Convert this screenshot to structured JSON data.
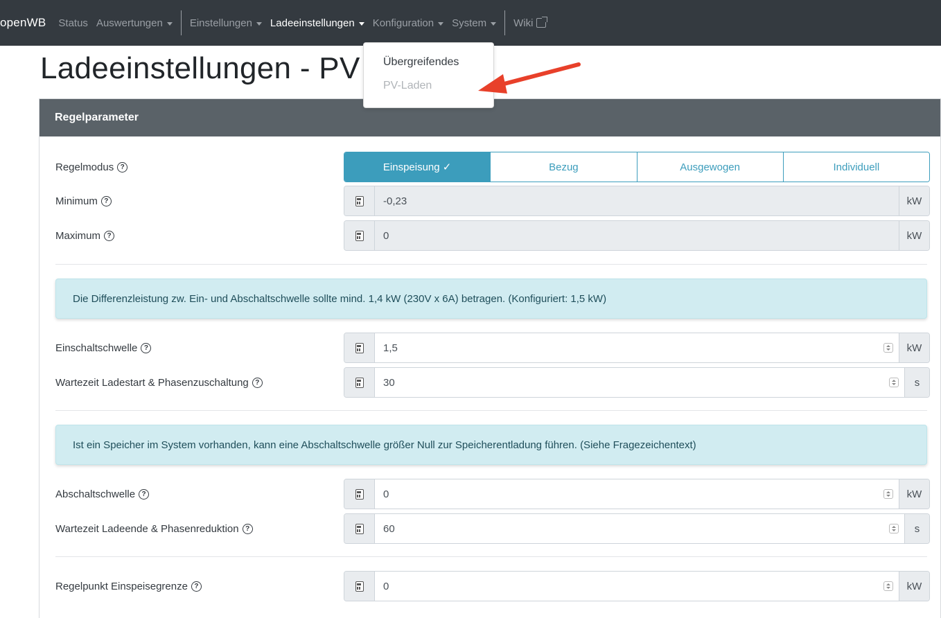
{
  "navbar": {
    "brand": "openWB",
    "items": [
      {
        "label": "Status"
      },
      {
        "label": "Auswertungen"
      },
      {
        "label": "Einstellungen"
      },
      {
        "label": "Ladeeinstellungen"
      },
      {
        "label": "Konfiguration"
      },
      {
        "label": "System"
      },
      {
        "label": "Wiki"
      }
    ]
  },
  "dropdown": {
    "items": [
      {
        "label": "Übergreifendes"
      },
      {
        "label": "PV-Laden"
      }
    ]
  },
  "page": {
    "title": "Ladeeinstellungen - PV"
  },
  "card": {
    "header": "Regelparameter",
    "regelmodus": {
      "label": "Regelmodus",
      "options": [
        "Einspeisung ✓",
        "Bezug",
        "Ausgewogen",
        "Individuell"
      ],
      "selected": "Einspeisung"
    },
    "minimum": {
      "label": "Minimum",
      "value": "-0,23",
      "unit": "kW"
    },
    "maximum": {
      "label": "Maximum",
      "value": "0",
      "unit": "kW"
    },
    "alert1": "Die Differenzleistung zw. Ein- und Abschaltschwelle sollte mind. 1,4 kW (230V x 6A) betragen. (Konfiguriert: 1,5 kW)",
    "einschaltschwelle": {
      "label": "Einschaltschwelle",
      "value": "1,5",
      "unit": "kW"
    },
    "wartezeit_start": {
      "label": "Wartezeit Ladestart & Phasenzuschaltung",
      "value": "30",
      "unit": "s"
    },
    "alert2": "Ist ein Speicher im System vorhanden, kann eine Abschaltschwelle größer Null zur Speicherentladung führen. (Siehe Fragezeichentext)",
    "abschaltschwelle": {
      "label": "Abschaltschwelle",
      "value": "0",
      "unit": "kW"
    },
    "wartezeit_ende": {
      "label": "Wartezeit Ladeende & Phasenreduktion",
      "value": "60",
      "unit": "s"
    },
    "regelpunkt": {
      "label": "Regelpunkt Einspeisegrenze",
      "value": "0",
      "unit": "kW"
    }
  },
  "colors": {
    "navbar": "#343a40",
    "accent": "#3c9dbc",
    "card_header": "#5a6268",
    "alert_bg": "#d1ecf1",
    "arrow": "#e8402a"
  }
}
